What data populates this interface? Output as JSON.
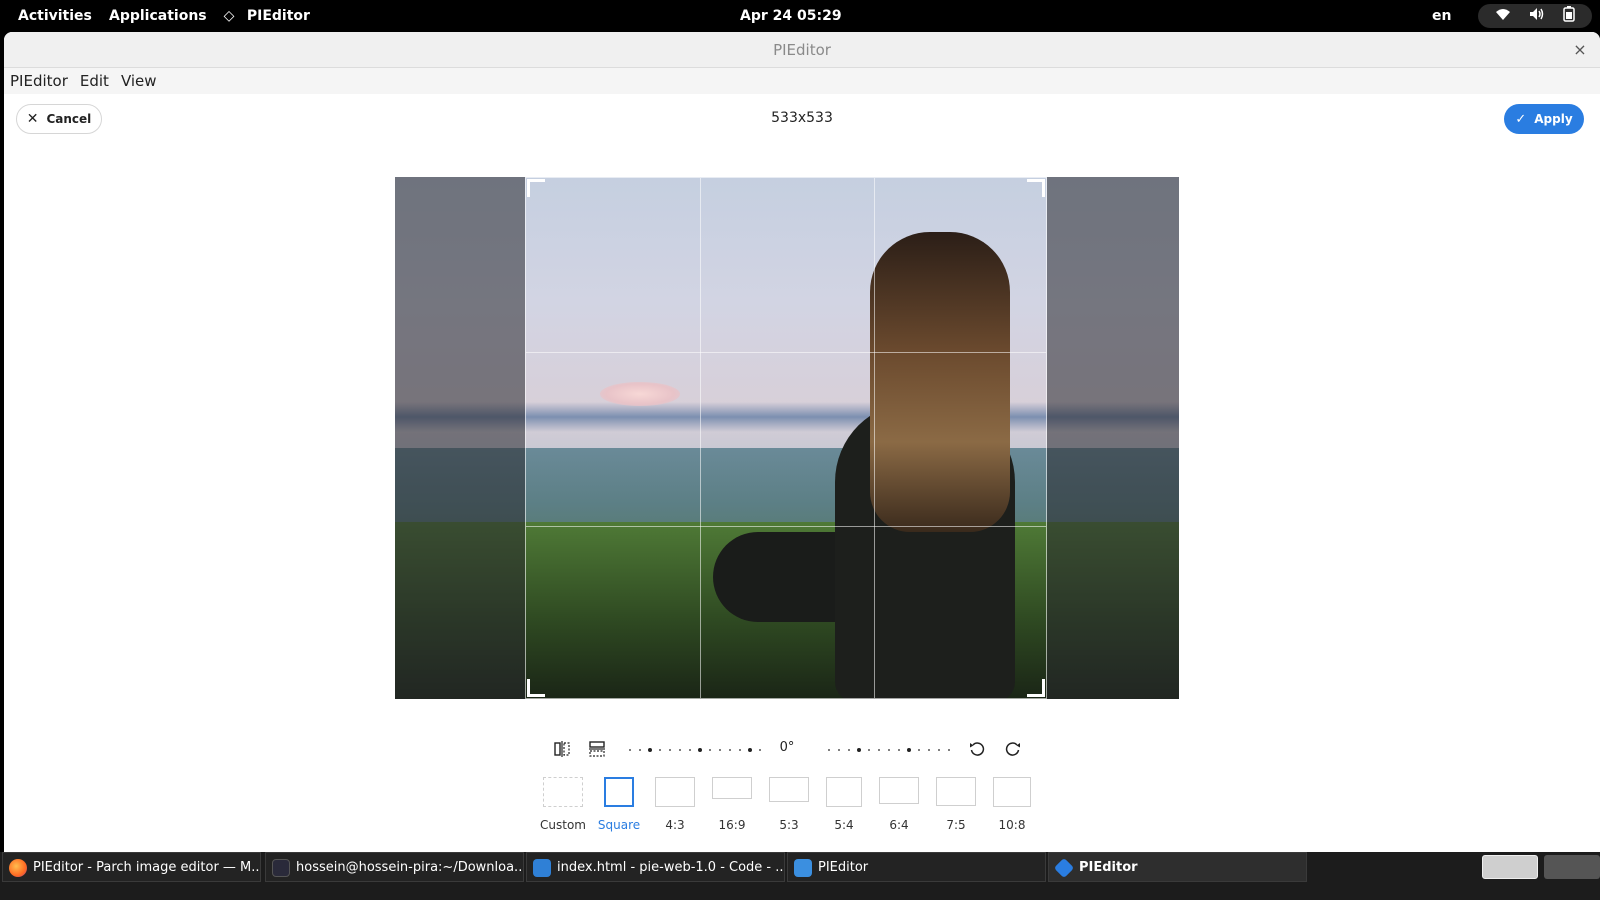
{
  "topbar": {
    "activities": "Activities",
    "applications": "Applications",
    "app_name": "PIEditor",
    "datetime": "Apr 24  05:29",
    "lang": "en"
  },
  "window": {
    "title": "PIEditor",
    "close": "×"
  },
  "menubar": {
    "items": [
      "PIEditor",
      "Edit",
      "View"
    ]
  },
  "toolbar": {
    "cancel_label": "Cancel",
    "dimensions": "533x533",
    "apply_label": "Apply"
  },
  "rotation": {
    "angle": "0°"
  },
  "ratios": [
    {
      "label": "Custom"
    },
    {
      "label": "Square"
    },
    {
      "label": "4:3"
    },
    {
      "label": "16:9"
    },
    {
      "label": "5:3"
    },
    {
      "label": "5:4"
    },
    {
      "label": "6:4"
    },
    {
      "label": "7:5"
    },
    {
      "label": "10:8"
    }
  ],
  "taskbar": {
    "items": [
      {
        "label": "PIEditor - Parch image editor — M..."
      },
      {
        "label": "hossein@hossein-pira:~/Downloa..."
      },
      {
        "label": "index.html - pie-web-1.0 - Code - ..."
      },
      {
        "label": "PIEditor"
      },
      {
        "label": "PIEditor"
      }
    ]
  },
  "colors": {
    "accent": "#2a7de1"
  }
}
